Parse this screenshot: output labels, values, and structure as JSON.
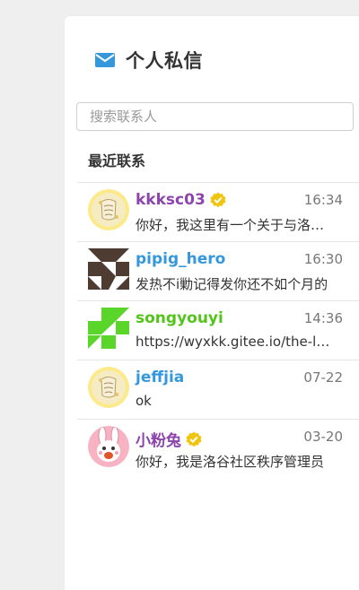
{
  "header": {
    "title": "个人私信",
    "icon": "mail-icon",
    "icon_color": "#3498db"
  },
  "search": {
    "placeholder": "搜索联系人",
    "value": ""
  },
  "recent_title": "最近联系",
  "contacts": [
    {
      "name": "kkksc03",
      "name_color": "#8e44ad",
      "verified": true,
      "time": "16:34",
      "preview": "你好，我这里有一个关于与洛谷合作的事情要与您沟通",
      "avatar": "scroll-avatar"
    },
    {
      "name": "pipig_hero",
      "name_color": "#3498db",
      "verified": false,
      "time": "16:30",
      "preview": "发热不i勦记得发你还不如个月的",
      "avatar": "identicon-brown-avatar"
    },
    {
      "name": "songyouyi",
      "name_color": "#52c41a",
      "verified": false,
      "time": "14:36",
      "preview": "https://wyxkk.gitee.io/the-luogu",
      "avatar": "identicon-green-avatar"
    },
    {
      "name": "jeffjia",
      "name_color": "#3498db",
      "verified": false,
      "time": "07-22",
      "preview": "ok",
      "avatar": "scroll-avatar"
    },
    {
      "name": "小粉兔",
      "name_color": "#8e44ad",
      "verified": true,
      "time": "03-20",
      "preview": "你好，我是洛谷社区秩序管理员",
      "avatar": "pink-rabbit-avatar"
    }
  ],
  "badge_color": "#f1c40f"
}
